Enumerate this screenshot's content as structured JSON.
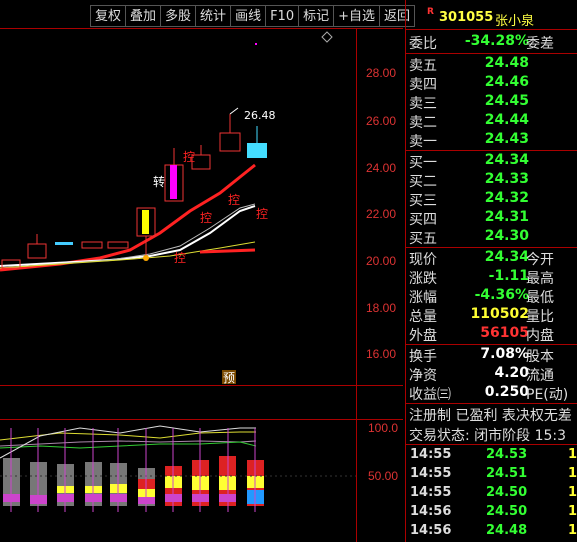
{
  "toolbar": {
    "items": [
      "复权",
      "叠加",
      "多股",
      "统计",
      "画线",
      "F10",
      "标记",
      "+自选",
      "返回"
    ]
  },
  "header": {
    "badge": "R",
    "code": "301055",
    "name": "张小泉"
  },
  "chart": {
    "price_labels": [
      "28.00",
      "26.00",
      "24.00",
      "22.00",
      "20.00",
      "18.00",
      "16.00"
    ],
    "high_annotation": "26.48",
    "turn_label": "转",
    "ctrl_labels": [
      "控",
      "控",
      "控",
      "控"
    ],
    "yu_label": "预",
    "ind_labels": [
      "100.0",
      "50.00"
    ]
  },
  "quote": {
    "weibi": {
      "label": "委比",
      "value": "-34.28%",
      "label2": "委差"
    },
    "sells": [
      {
        "label": "卖五",
        "price": "24.48"
      },
      {
        "label": "卖四",
        "price": "24.46"
      },
      {
        "label": "卖三",
        "price": "24.45"
      },
      {
        "label": "卖二",
        "price": "24.44"
      },
      {
        "label": "卖一",
        "price": "24.43"
      }
    ],
    "buys": [
      {
        "label": "买一",
        "price": "24.34"
      },
      {
        "label": "买二",
        "price": "24.33"
      },
      {
        "label": "买三",
        "price": "24.32"
      },
      {
        "label": "买四",
        "price": "24.31"
      },
      {
        "label": "买五",
        "price": "24.30"
      }
    ],
    "stats": [
      {
        "label": "现价",
        "value": "24.34",
        "label2": "今开"
      },
      {
        "label": "涨跌",
        "value": "-1.11",
        "label2": "最高"
      },
      {
        "label": "涨幅",
        "value": "-4.36%",
        "label2": "最低"
      },
      {
        "label": "总量",
        "value": "110502",
        "label2": "量比"
      },
      {
        "label": "外盘",
        "value": "56105",
        "label2": "内盘"
      }
    ],
    "stats2": [
      {
        "label": "换手",
        "value": "7.08%",
        "label2": "股本"
      },
      {
        "label": "净资",
        "value": "4.20",
        "label2": "流通"
      },
      {
        "label": "收益㈢",
        "value": "0.250",
        "label2": "PE(动)"
      }
    ],
    "info1": "注册制 已盈利 表决权无差",
    "info2": "交易状态: 闭市阶段 15:3",
    "ticks": [
      {
        "time": "14:55",
        "price": "24.53",
        "q": "1"
      },
      {
        "time": "14:55",
        "price": "24.51",
        "q": "1"
      },
      {
        "time": "14:55",
        "price": "24.50",
        "q": "1"
      },
      {
        "time": "14:56",
        "price": "24.50",
        "q": "1"
      },
      {
        "time": "14:56",
        "price": "24.48",
        "q": "1"
      }
    ]
  }
}
